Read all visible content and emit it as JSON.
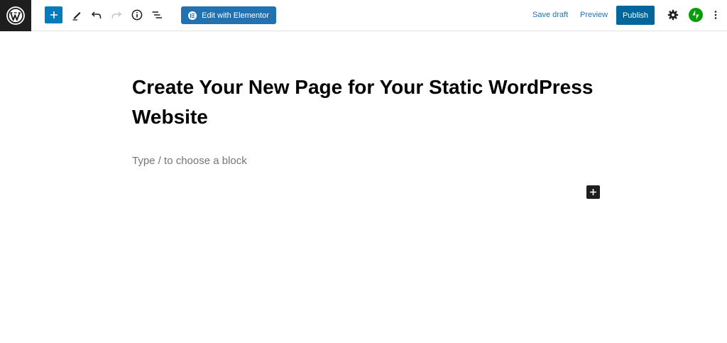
{
  "toolbar": {
    "elementor_label": "Edit with Elementor",
    "save_draft_label": "Save draft",
    "preview_label": "Preview",
    "publish_label": "Publish"
  },
  "editor": {
    "title": "Create Your New Page for Your Static WordPress Website",
    "block_placeholder": "Type / to choose a block"
  },
  "colors": {
    "accent": "#007cba",
    "publish": "#00669b",
    "elementor": "#2271b1",
    "jetpack": "#069e08",
    "logo_bg": "#1e1e1e"
  },
  "icons": [
    "wordpress-icon",
    "plus-icon",
    "pencil-icon",
    "undo-icon",
    "redo-icon",
    "info-icon",
    "list-view-icon",
    "elementor-icon",
    "gear-icon",
    "jetpack-icon",
    "more-vertical-icon"
  ]
}
